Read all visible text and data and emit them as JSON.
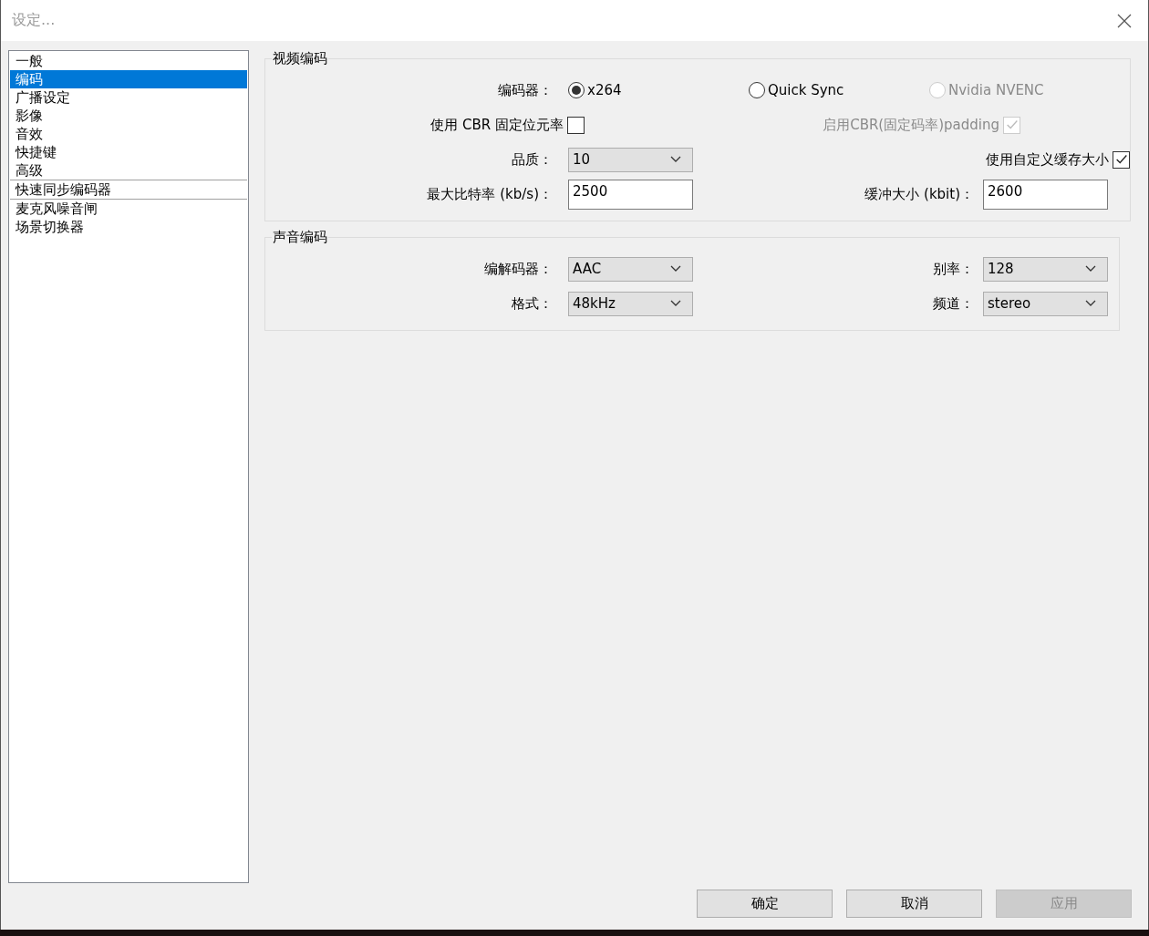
{
  "window": {
    "title": "设定..."
  },
  "sidebar": {
    "items": [
      {
        "label": "一般",
        "selected": false,
        "divider_before": false
      },
      {
        "label": "编码",
        "selected": true,
        "divider_before": false
      },
      {
        "label": "广播设定",
        "selected": false,
        "divider_before": false
      },
      {
        "label": "影像",
        "selected": false,
        "divider_before": false
      },
      {
        "label": "音效",
        "selected": false,
        "divider_before": false
      },
      {
        "label": "快捷键",
        "selected": false,
        "divider_before": false
      },
      {
        "label": "高级",
        "selected": false,
        "divider_before": false
      },
      {
        "label": "快速同步编码器",
        "selected": false,
        "divider_before": true
      },
      {
        "label": "麦克风噪音闸",
        "selected": false,
        "divider_before": true
      },
      {
        "label": "场景切换器",
        "selected": false,
        "divider_before": false
      }
    ]
  },
  "video_encoding": {
    "title": "视频编码",
    "encoder": {
      "label": "编码器：",
      "options": [
        {
          "label": "x264",
          "selected": true,
          "disabled": false
        },
        {
          "label": "Quick Sync",
          "selected": false,
          "disabled": false
        },
        {
          "label": "Nvidia NVENC",
          "selected": false,
          "disabled": true
        }
      ]
    },
    "use_cbr": {
      "label": "使用 CBR 固定位元率",
      "checked": false,
      "disabled": false
    },
    "cbr_padding": {
      "label": "启用CBR(固定码率)padding",
      "checked": true,
      "disabled": true
    },
    "quality": {
      "label": "品质：",
      "value": "10"
    },
    "custom_buffer": {
      "label": "使用自定义缓存大小",
      "checked": true,
      "disabled": false
    },
    "max_bitrate": {
      "label": "最大比特率 (kb/s)：",
      "value": "2500"
    },
    "buffer_size": {
      "label": "缓冲大小 (kbit)：",
      "value": "2600"
    }
  },
  "audio_encoding": {
    "title": "声音编码",
    "codec": {
      "label": "编解码器：",
      "value": "AAC"
    },
    "bitrate": {
      "label": "别率：",
      "value": "128"
    },
    "format": {
      "label": "格式：",
      "value": "48kHz"
    },
    "channels": {
      "label": "频道：",
      "value": "stereo"
    }
  },
  "buttons": [
    {
      "label": "确定",
      "disabled": false
    },
    {
      "label": "取消",
      "disabled": false
    },
    {
      "label": "应用",
      "disabled": true
    }
  ]
}
